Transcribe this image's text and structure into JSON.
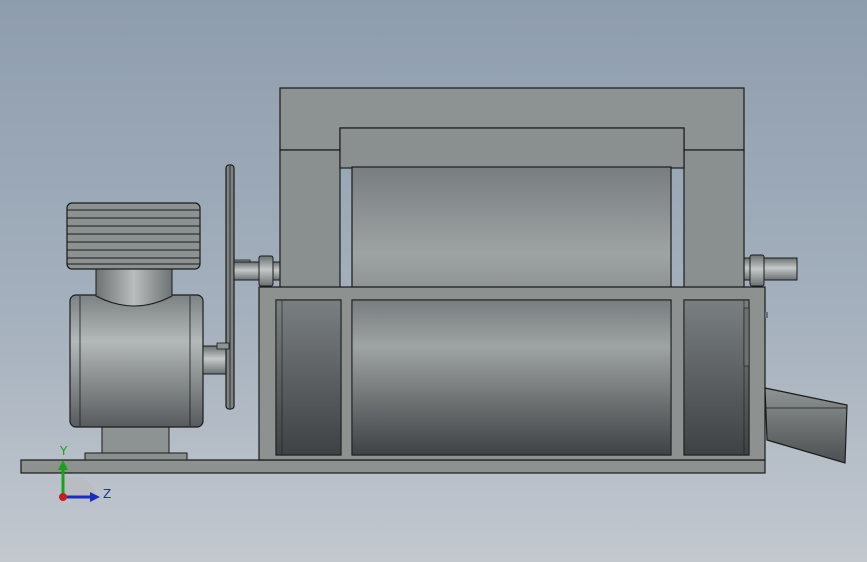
{
  "scene": {
    "view": "side-view",
    "background": {
      "top": "#8e9dae",
      "bottom": "#c3c8cf"
    },
    "colors": {
      "body_dark": "#3f4244",
      "body_light": "#9ea3a4",
      "frame": "#8d9291",
      "hopper": "#7d8283",
      "outline": "#1b1b1b"
    }
  },
  "triad": {
    "y_label": "Y",
    "z_label": "Z",
    "colors": {
      "y": "#1aa11a",
      "z": "#1a2cc4",
      "origin": "#c81d1d"
    }
  }
}
